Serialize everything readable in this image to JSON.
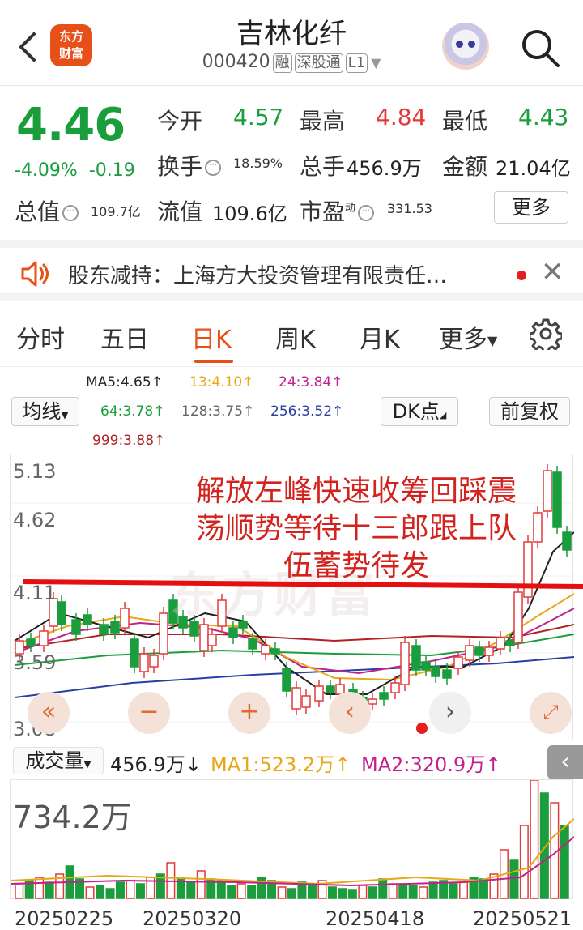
{
  "header": {
    "back_icon": "chevron-left-icon",
    "logo_line1": "东方",
    "logo_line2": "财富",
    "title": "吉林化纤",
    "code": "000420",
    "tags": [
      "融",
      "深股通",
      "L1"
    ]
  },
  "quote": {
    "price": "4.46",
    "pct": "-4.09%",
    "chg": "-0.19",
    "open_label": "今开",
    "open": "4.57",
    "high_label": "最高",
    "high": "4.84",
    "low_label": "最低",
    "low": "4.43",
    "turnover_label": "换手",
    "turnover": "18.59%",
    "volume_label": "总手",
    "volume": "456.9万",
    "amount_label": "金额",
    "amount": "21.04亿",
    "mktcap_label": "总值",
    "mktcap": "109.7亿",
    "float_label": "流值",
    "float": "109.6亿",
    "pe_label": "市盈",
    "pe_sup": "动",
    "pe": "331.53",
    "more": "更多"
  },
  "notice": {
    "text": "股东减持：上海方大投资管理有限责任…"
  },
  "tabs": [
    "分时",
    "五日",
    "日K",
    "周K",
    "月K",
    "更多"
  ],
  "active_tab": "日K",
  "ma": {
    "ma5": "MA5:4.65↑",
    "ma13": "13:4.10↑",
    "ma24": "24:3.84↑",
    "ma64": "64:3.78↑",
    "ma128": "128:3.75↑",
    "ma256": "256:3.52↑",
    "ma999": "999:3.88↑",
    "junxian": "均线",
    "dk": "DK点",
    "fuquan": "前复权"
  },
  "chart": {
    "y_labels": [
      "5.13",
      "4.62",
      "4.11",
      "3.59",
      "3.08"
    ],
    "annotation_line1": "解放左峰快速收筹回踩震",
    "annotation_line2": "荡顺势等待十三郎跟上队",
    "annotation_line3": "伍蓄势待发",
    "watermark": "东方财富"
  },
  "volume": {
    "label": "成交量",
    "value": "456.9万↓",
    "ma1": "MA1:523.2万↑",
    "ma2": "MA2:320.9万↑",
    "max": "734.2万"
  },
  "dates": [
    "20250225",
    "20250320",
    "20250418",
    "20250521"
  ],
  "colors": {
    "up": "#e23a3a",
    "down": "#1a9d3c",
    "accent": "#e8501a"
  }
}
